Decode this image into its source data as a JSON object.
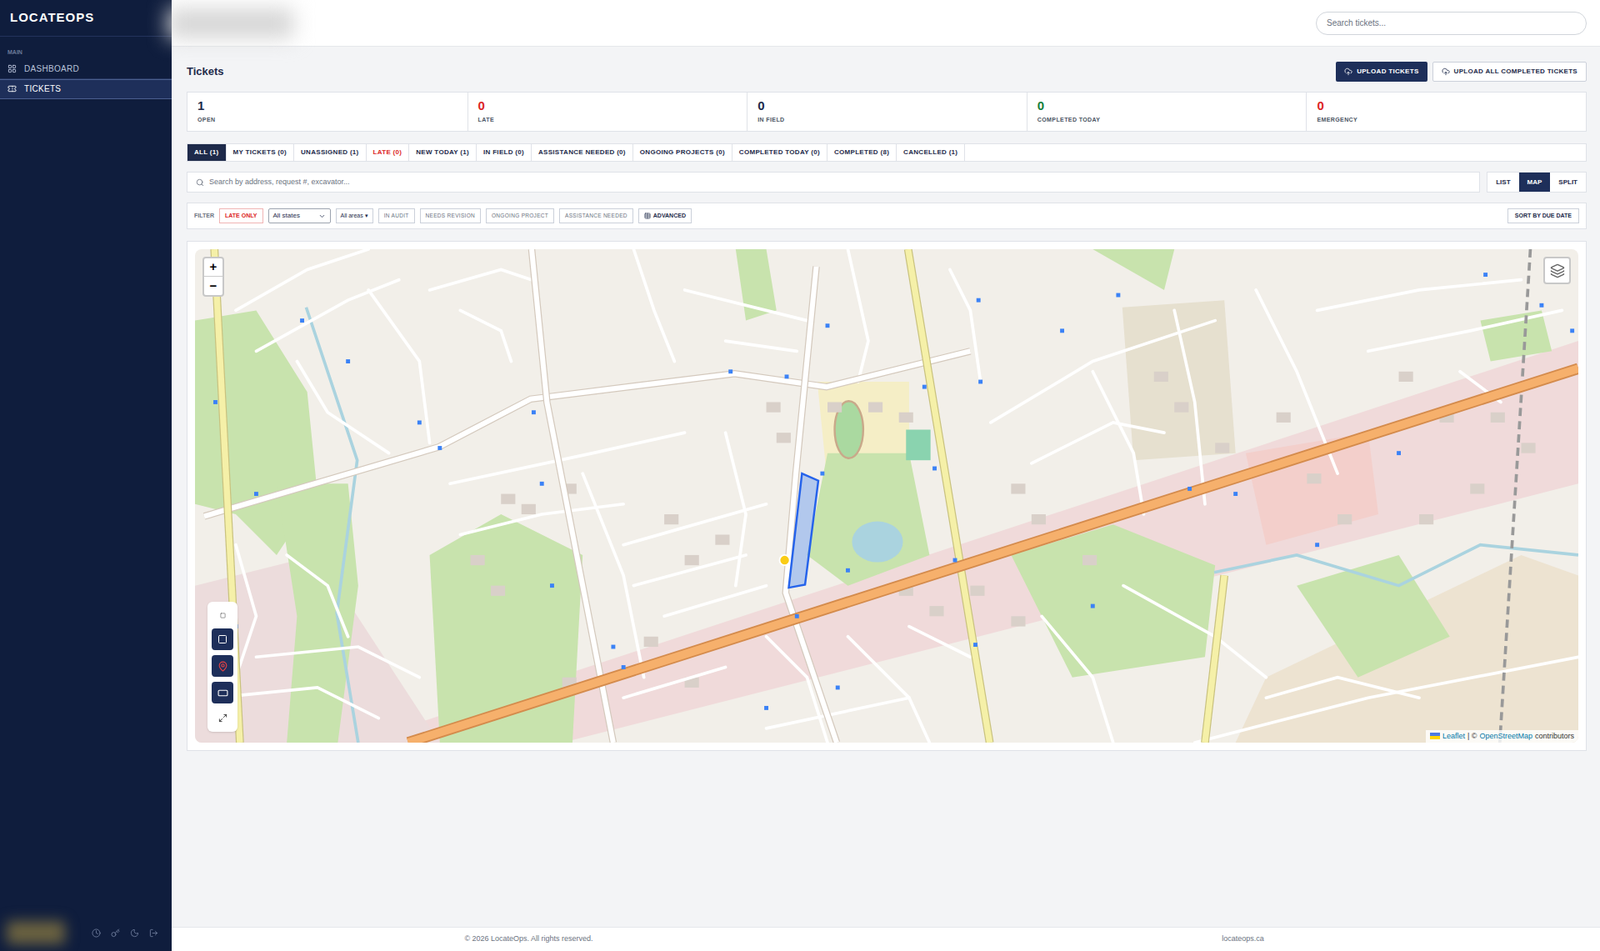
{
  "app": {
    "logo": "LOCATEOPS",
    "copyright": "© 2026 LocateOps. All rights reserved.",
    "site": "locateops.ca"
  },
  "sidebar": {
    "section": "MAIN",
    "items": [
      {
        "label": "DASHBOARD",
        "selected": false
      },
      {
        "label": "TICKETS",
        "selected": true
      }
    ]
  },
  "header": {
    "search_placeholder": "Search tickets..."
  },
  "page": {
    "title": "Tickets",
    "buttons": [
      {
        "label": "UPLOAD TICKETS",
        "primary": true
      },
      {
        "label": "UPLOAD ALL COMPLETED TICKETS",
        "primary": false
      }
    ]
  },
  "stats": [
    {
      "value": "1",
      "label": "OPEN",
      "color": "#1e2a4a"
    },
    {
      "value": "0",
      "label": "LATE",
      "color": "#dc2626"
    },
    {
      "value": "0",
      "label": "IN FIELD",
      "color": "#1e2a4a"
    },
    {
      "value": "0",
      "label": "COMPLETED TODAY",
      "color": "#15803d"
    },
    {
      "value": "0",
      "label": "EMERGENCY",
      "color": "#dc2626"
    }
  ],
  "tabs": [
    {
      "label": "ALL (1)",
      "selected": true,
      "color": "#1e2a4a"
    },
    {
      "label": "MY TICKETS (0)",
      "selected": false,
      "color": "#1e2a4a"
    },
    {
      "label": "UNASSIGNED (1)",
      "selected": false,
      "color": "#1e2a4a"
    },
    {
      "label": "LATE (0)",
      "selected": false,
      "color": "#dc2626"
    },
    {
      "label": "NEW TODAY (1)",
      "selected": false,
      "color": "#1e2a4a"
    },
    {
      "label": "IN FIELD (0)",
      "selected": false,
      "color": "#1e2a4a"
    },
    {
      "label": "ASSISTANCE NEEDED (0)",
      "selected": false,
      "color": "#1e2a4a"
    },
    {
      "label": "ONGOING PROJECTS (0)",
      "selected": false,
      "color": "#1e2a4a"
    },
    {
      "label": "COMPLETED TODAY (0)",
      "selected": false,
      "color": "#1e2a4a"
    },
    {
      "label": "COMPLETED (8)",
      "selected": false,
      "color": "#1e2a4a"
    },
    {
      "label": "CANCELLED (1)",
      "selected": false,
      "color": "#1e2a4a"
    }
  ],
  "search": {
    "placeholder": "Search by address, request #, excavator..."
  },
  "views": [
    {
      "label": "LIST",
      "selected": false
    },
    {
      "label": "MAP",
      "selected": true
    },
    {
      "label": "SPLIT",
      "selected": false
    }
  ],
  "filters": {
    "label": "FILTER",
    "late_only": "LATE ONLY",
    "states": "All states",
    "areas": "All areas ▾",
    "chips": [
      "IN AUDIT",
      "NEEDS REVISION",
      "ONGOING PROJECT",
      "ASSISTANCE NEEDED"
    ],
    "advanced": "ADVANCED",
    "sort": "SORT BY DUE DATE"
  },
  "map": {
    "zoom_in": "+",
    "zoom_out": "−",
    "attribution_link": "Leaflet",
    "attribution_sep": "| ©",
    "attribution_osm": "OpenStreetMap",
    "attribution_tail": "contributors"
  }
}
